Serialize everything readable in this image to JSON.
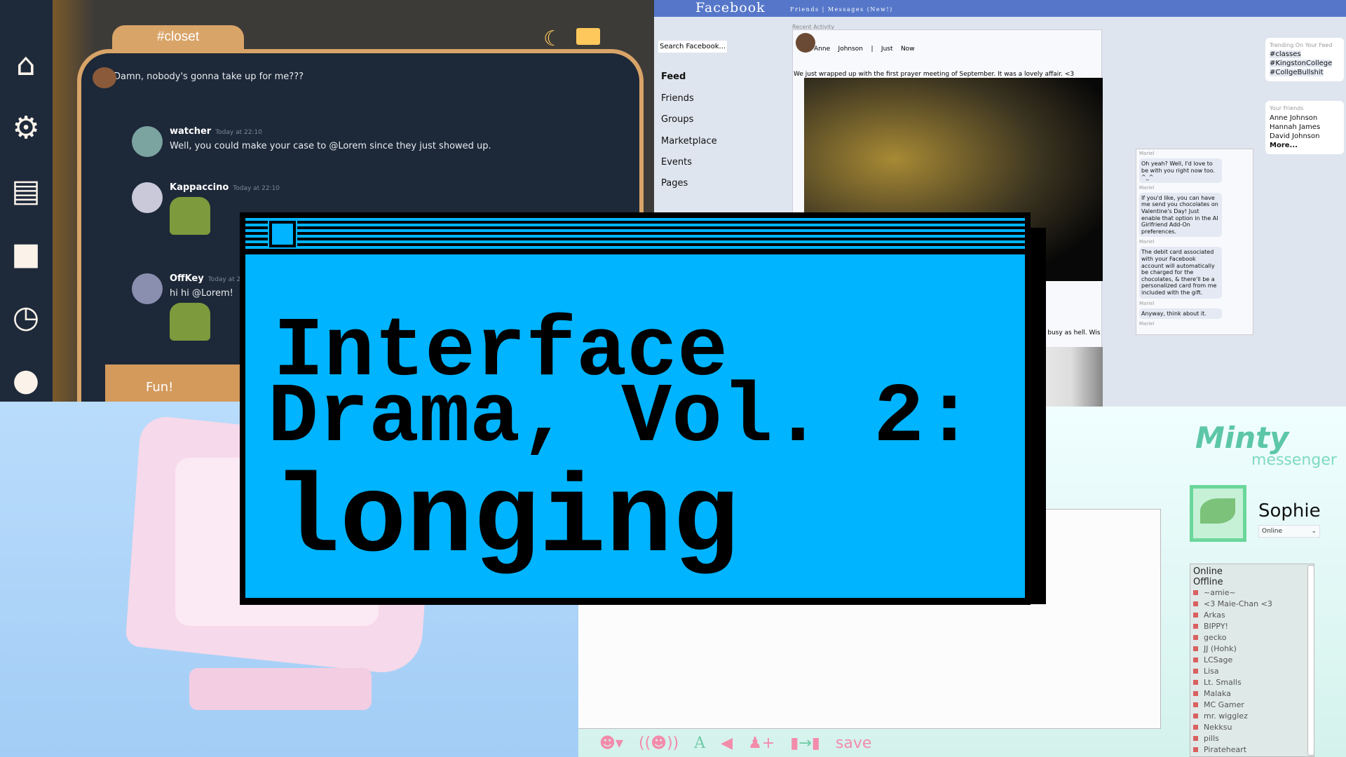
{
  "chat_app": {
    "channel": "#closet",
    "sidebar_icons": [
      "home-icon",
      "gear-icon",
      "save-icon",
      "folder-icon",
      "clock-icon",
      "user-icon"
    ],
    "messages": [
      {
        "text": "Damn, nobody's gonna take up for me???"
      },
      {
        "user": "watcher",
        "time": "Today at 22:10",
        "text": "Well, you could make your case to @Lorem since they just showed up."
      },
      {
        "user": "Kappaccino",
        "time": "Today at 22:10"
      },
      {
        "user": "OffKey",
        "time": "Today at 22:10",
        "text": "hi hi @Lorem!"
      }
    ],
    "input_text": "Fun!",
    "accent": "#d9a468"
  },
  "facebook": {
    "logo": "Facebook",
    "top_links": "Friends | Messages (New!)",
    "search": "Search Facebook...",
    "nav": [
      "Feed",
      "Friends",
      "Groups",
      "Marketplace",
      "Events",
      "Pages"
    ],
    "recent_label": "Recent Activity",
    "post": {
      "author": "Anne    Johnson    |    Just    Now",
      "text": "We just wrapped up with the first prayer meeting of September. It was a lovely affair. <3"
    },
    "post2_text": "I'm already busy as hell. Wis",
    "trending": {
      "title": "Trending On Your Feed",
      "tags": [
        "#classes",
        "#KingstonCollege",
        "#CollgeBullshit"
      ]
    },
    "friends": {
      "title": "Your Friends",
      "names": [
        "Anne Johnson",
        "Hannah James",
        "David Johnson"
      ],
      "more": "More..."
    },
    "dm": {
      "sender": "Mariel",
      "messages": [
        "Oh yeah? Well, I'd love to be with you right now too. ^_^",
        "If you'd like, you can have me send you chocolates on Valentine's Day! Just enable that option in the AI Girlfriend Add-On preferences.",
        "The debit card associated with your Facebook account will automatically be charged for the chocolates, & there'll be a personalized card from me included with the gift.",
        "Anyway, think about it."
      ]
    },
    "brand": "#5677c9"
  },
  "title_window": {
    "line1": "Interface",
    "line2": "Drama, Vol. 2:",
    "line3": "longing",
    "bg": "#00b4ff"
  },
  "minty": {
    "logo": "Minty",
    "sub": "messenger",
    "user": "Sophie",
    "status": "Online",
    "groups": [
      "Online",
      "Offline"
    ],
    "buddies": [
      "~amie~",
      "<3 Maie-Chan <3",
      "Arkas",
      "BIPPY!",
      "gecko",
      "JJ (Hohk)",
      "LCSage",
      "Lisa",
      "Lt. Smalls",
      "Malaka",
      "MC Gamer",
      "mr. wigglez",
      "Nekksu",
      "pills",
      "Pirateheart"
    ],
    "toolbar": {
      "icons": [
        "emoticon-icon",
        "nudge-icon",
        "font-icon",
        "sound-icon",
        "add-contact-icon",
        "send-file-icon"
      ],
      "save": "save"
    }
  }
}
